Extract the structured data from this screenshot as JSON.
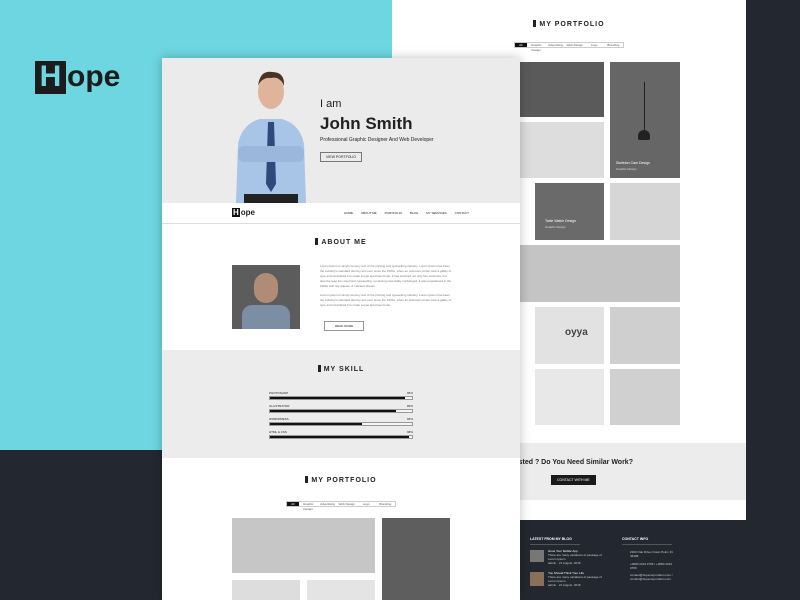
{
  "brand": {
    "logo_letter": "H",
    "logo_rest": "ope"
  },
  "back_page": {
    "portfolio_title": "MY PORTFOLIO",
    "filters": [
      "All",
      "Graphic Design",
      "Advertising",
      "Web Design",
      "Logo",
      "Branding"
    ],
    "tiles": [
      {
        "title": "Skeleton Cam Design",
        "sub": "Graphic Design"
      },
      {
        "title": "Table Watch Design",
        "sub": "Graphic Design"
      },
      {
        "title": "oyya",
        "sub": ""
      }
    ],
    "cta_text": "rested ? Do You Need Similar Work?",
    "cta_button": "CONTACT WITH ME",
    "footer": {
      "blog_title": "LATEST FROM MY BLOG",
      "posts": [
        {
          "title": "Grow Your Mobile App",
          "excerpt": "There are many variations of passage of Lorem Ipsum",
          "author": "admin",
          "date": "21 August, 2016"
        },
        {
          "title": "You Should Think Your Life",
          "excerpt": "There are many variations of passage of Lorem Ipsum",
          "author": "admin",
          "date": "21 August, 2016"
        }
      ],
      "contact_title": "CONTACT INFO",
      "address": "2300 Oak Drive Crown Point, IN 46308",
      "phones": "+0080 2343 3766 / +0080 2343 3766",
      "emails": "contact@hopecorporation.com / contact@hopecorporation.com"
    }
  },
  "hero": {
    "greeting": "I am",
    "name": "John Smith",
    "subtitle": "Professional Graphic Designer And Web Developer",
    "button": "VIEW PORTFOLIO"
  },
  "nav": {
    "logo_letter": "H",
    "logo_rest": "ope",
    "items": [
      "HOME",
      "ABOUT ME",
      "PORTFOLIO",
      "BLOG",
      "MY SERVICES",
      "CONTACT"
    ]
  },
  "about": {
    "title": "ABOUT ME",
    "p1": "Lorem Ipsum is simply dummy text of the printing and typesetting industry. Lorem Ipsum has been the industry's standard dummy text ever since the 1500s, when an unknown printer took a galley of type and scrambled it to make a type specimen book. It has survived not only five centuries, but also the leap into electronic typesetting, remaining essentially unchanged. It was popularised in the 1960s with the release of Letraset sheets.",
    "p2": "Lorem Ipsum is simply dummy text of the printing and typesetting industry. Lorem Ipsum has been the industry's standard dummy text ever since the 1500s, when an unknown printer took a galley of type and scrambled it to make a type specimen book.",
    "button": "READ MORE"
  },
  "skills": {
    "title": "MY SKILL",
    "items": [
      {
        "name": "PHOTOSHOP",
        "percent": 95,
        "label": "95%"
      },
      {
        "name": "ILLUSTRATOR",
        "percent": 89,
        "label": "89%"
      },
      {
        "name": "WORDPRESS",
        "percent": 65,
        "label": "65%"
      },
      {
        "name": "HTML & CSS",
        "percent": 98,
        "label": "98%"
      }
    ]
  },
  "portfolio": {
    "title": "MY PORTFOLIO",
    "filters": [
      "All",
      "Graphic Design",
      "Advertising",
      "Web Design",
      "Logo",
      "Branding"
    ]
  }
}
